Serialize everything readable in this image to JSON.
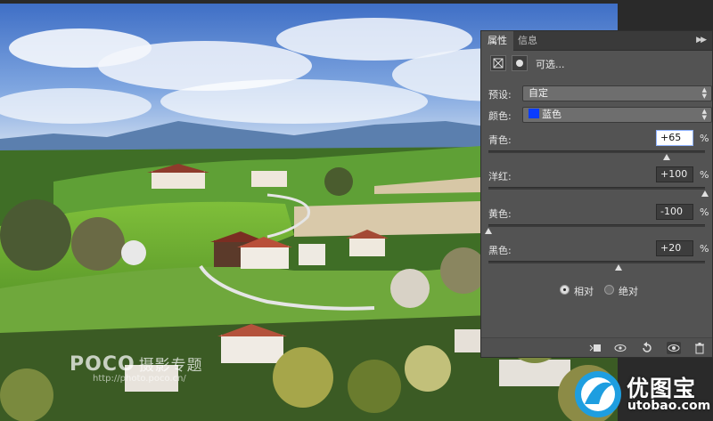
{
  "panel": {
    "tabs": [
      {
        "label": "属性",
        "active": true
      },
      {
        "label": "信息",
        "active": false
      }
    ],
    "menu_icon": "double-chevron-menu-icon",
    "header_title": "可选...",
    "preset": {
      "label": "预设:",
      "value": "自定"
    },
    "colors": {
      "label": "颜色:",
      "value": "蓝色",
      "swatch_hex": "#0a3cff"
    },
    "sliders": [
      {
        "label": "青色:",
        "value": "+65",
        "percent": 65,
        "focused": true
      },
      {
        "label": "洋红:",
        "value": "+100",
        "percent": 100,
        "focused": false
      },
      {
        "label": "黄色:",
        "value": "-100",
        "percent": -100,
        "focused": false
      },
      {
        "label": "黑色:",
        "value": "+20",
        "percent": 20,
        "focused": false
      }
    ],
    "percent_unit": "%",
    "method": {
      "relative": "相对",
      "absolute": "绝对",
      "selected": "relative"
    },
    "bottom_icons": [
      "clip-to-layer-icon",
      "view-previous-icon",
      "reset-icon",
      "visibility-eye-icon",
      "trash-icon"
    ]
  },
  "watermark": {
    "brand": "POCO",
    "brand_zh": "摄影专题",
    "url": "http://photo.poco.cn/"
  },
  "logo": {
    "text": "优图宝",
    "url": "utobao.com"
  },
  "colors": {
    "panel_bg": "#535353",
    "tab_bar": "#3a3a3a",
    "accent_blue": "#0a3cff"
  }
}
